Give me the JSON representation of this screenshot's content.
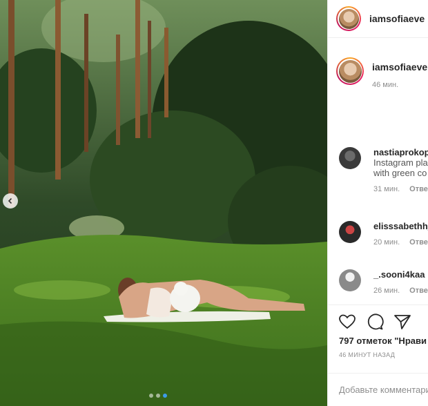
{
  "post": {
    "username": "iamsofiaeve",
    "caption_time": "46 мин."
  },
  "comments": [
    {
      "username": "nastiaprokop",
      "text_lines": [
        "Instagram pla",
        "with green co"
      ],
      "time": "31 мин.",
      "reply": "Отве"
    },
    {
      "username": "elisssabethh_",
      "text_lines": [],
      "time": "20 мин.",
      "reply": "Отве"
    },
    {
      "username": "_.sooni4kaa",
      "text_lines": [],
      "time": "26 мин.",
      "reply": "Отве"
    }
  ],
  "actions": {
    "likes_count": "797",
    "likes_word": "отметок",
    "likes_suffix": "\"Нрави",
    "time_ago": "46 МИНУТ НАЗАД"
  },
  "comment_box": {
    "placeholder": "Добавьте комментарий"
  },
  "carousel": {
    "slide": 3,
    "total": 3
  },
  "icons": [
    "chevron-left-icon",
    "heart-icon",
    "comment-icon",
    "share-icon"
  ]
}
